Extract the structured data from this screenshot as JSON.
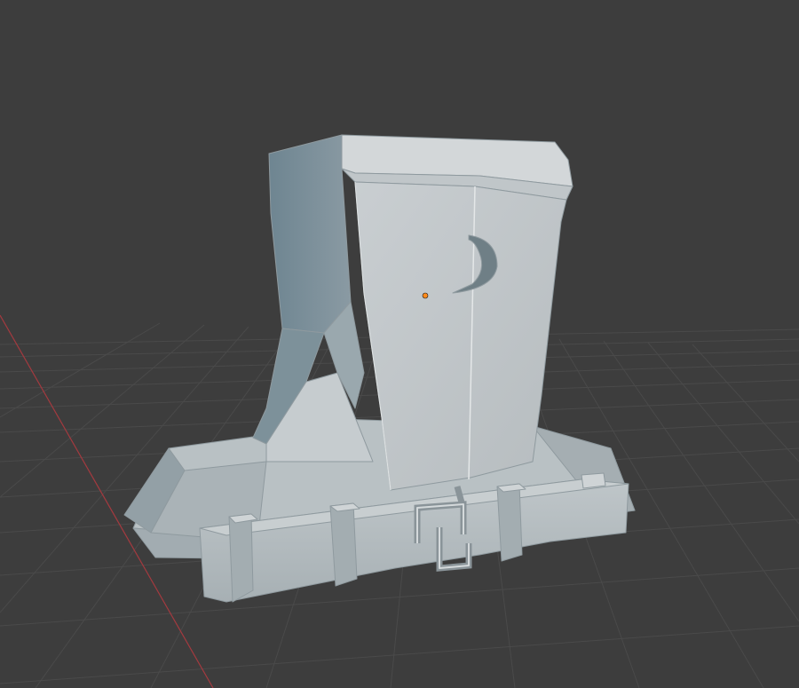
{
  "viewport": {
    "background_color": "#3d3d3d",
    "grid_color": "#4a4a4a",
    "x_axis_color": "#a33a3f",
    "model_color": "#a9b3b7",
    "origin_color": "#ff8a1a",
    "shading": "solid"
  }
}
